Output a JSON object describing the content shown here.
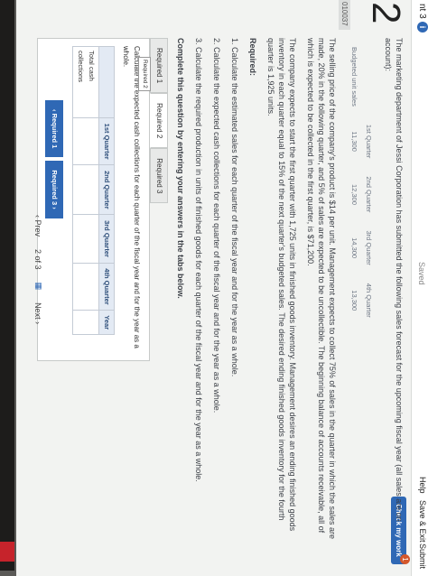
{
  "topbar": {
    "question_counter": "nt 3",
    "saved": "Saved",
    "help": "Help",
    "save_exit": "Save & Exit",
    "submit": "Submit",
    "check_my_work": "Check my work",
    "alert_count": "1"
  },
  "question": {
    "number": "2",
    "points_badge": "010037",
    "intro": "The marketing department of Jessi Corporation has submitted the following sales forecast for the upcoming fiscal year (all sales are on account):",
    "sales_table": {
      "headers": [
        "",
        "1st Quarter",
        "2nd Quarter",
        "3rd Quarter",
        "4th Quarter"
      ],
      "row_label": "Budgeted unit sales",
      "values": [
        "11,300",
        "12,300",
        "14,300",
        "13,300"
      ]
    },
    "para2": "The selling price of the company's product is $14 per unit. Management expects to collect 75% of sales in the quarter in which the sales are made, 20% in the following quarter, and 5% of sales are expected to be uncollectible. The beginning balance of accounts receivable, all of which is expected to be collected in the first quarter, is $71,200.",
    "para3": "The company expects to start the first quarter with 1,725 units in finished goods inventory. Management desires an ending finished goods inventory in each quarter equal to 15% of the next quarter's budgeted sales. The desired ending finished goods inventory for the fourth quarter is 1,925 units.",
    "required_title": "Required:",
    "required_items": [
      "1. Calculate the estimated sales for each quarter of the fiscal year and for the year as a whole.",
      "2. Calculate the expected cash collections for each quarter of the fiscal year and for the year as a whole.",
      "3. Calculate the required production in units of finished goods for each quarter of the fiscal year and for the year as a whole."
    ],
    "complete_instruction": "Complete this question by entering your answers in the tabs below."
  },
  "tabs": [
    "Required 1",
    "Required 2",
    "Required 3"
  ],
  "panel": {
    "instruction": "Calculate the expected cash collections for each quarter of the fiscal year and for the year as a whole.",
    "tooltip": "Required 2",
    "columns": [
      "",
      "1st Quarter",
      "2nd Quarter",
      "3rd Quarter",
      "4th Quarter",
      "Year"
    ],
    "row_label": "Total cash collections"
  },
  "nav": {
    "prev_required": "Required 1",
    "next_required": "Required 3"
  },
  "pager": {
    "prev": "Prev",
    "position": "2 of 3",
    "next": "Next"
  },
  "colors": {
    "accent": "#2f68b5",
    "alert": "#d4572b",
    "background": "#f2f3f1"
  }
}
